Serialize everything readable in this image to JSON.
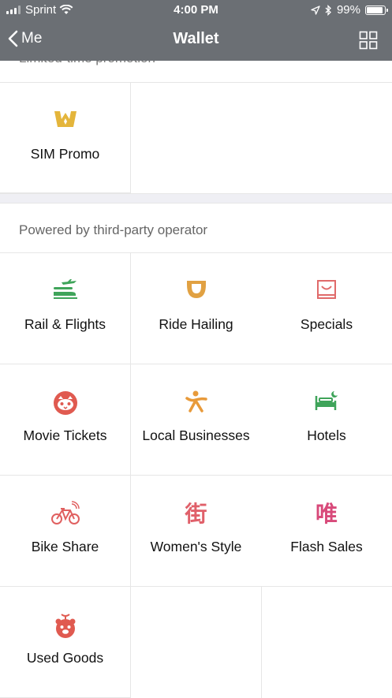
{
  "status_bar": {
    "carrier": "Sprint",
    "time": "4:00 PM",
    "battery": "99%",
    "battery_level": 0.99
  },
  "nav": {
    "back_label": "Me",
    "title": "Wallet"
  },
  "promotion_section": {
    "label": "Limited-time promotion",
    "items": [
      {
        "label": "SIM Promo",
        "icon": "sim-promo-icon",
        "color": "#e4b53b"
      }
    ]
  },
  "third_party_section": {
    "label": "Powered by third-party operator",
    "items": [
      {
        "label": "Rail & Flights",
        "icon": "train-plane-icon",
        "color": "#3fa45a"
      },
      {
        "label": "Ride Hailing",
        "icon": "didi-icon",
        "color": "#e1a142"
      },
      {
        "label": "Specials",
        "icon": "shopping-bag-icon",
        "color": "#e06a6a"
      },
      {
        "label": "Movie Tickets",
        "icon": "cat-face-icon",
        "color": "#e05a50"
      },
      {
        "label": "Local Businesses",
        "icon": "person-icon",
        "color": "#e89a3a"
      },
      {
        "label": "Hotels",
        "icon": "bed-icon",
        "color": "#3fa45a"
      },
      {
        "label": "Bike Share",
        "icon": "bike-icon",
        "color": "#e06060"
      },
      {
        "label": "Women's Style",
        "icon": "jie-character-icon",
        "glyph": "街",
        "color": "#e0606a"
      },
      {
        "label": "Flash Sales",
        "icon": "wei-character-icon",
        "glyph": "唯",
        "color": "#d84a7a"
      },
      {
        "label": "Used Goods",
        "icon": "bear-face-icon",
        "color": "#e05a50"
      }
    ]
  }
}
